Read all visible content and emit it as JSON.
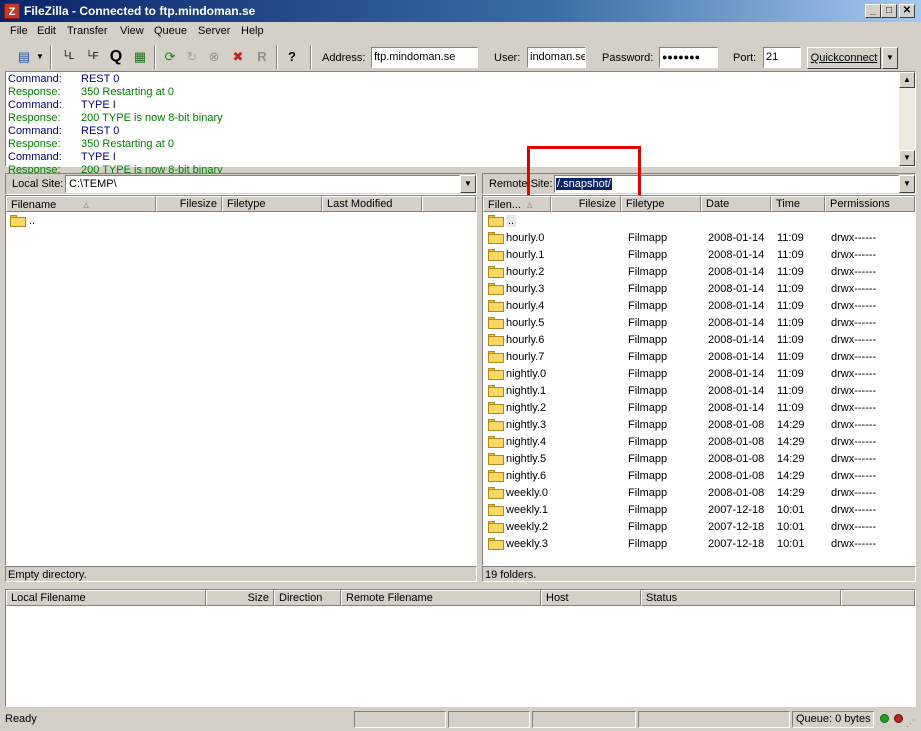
{
  "window": {
    "app_icon": "Z",
    "title": "FileZilla - Connected to ftp.mindoman.se"
  },
  "menu": [
    "File",
    "Edit",
    "Transfer",
    "View",
    "Queue",
    "Server",
    "Help"
  ],
  "toolbar": {
    "address_label": "Address:",
    "address_value": "ftp.mindoman.se",
    "user_label": "User:",
    "user_value": "indoman.se",
    "password_label": "Password:",
    "password_value": "●●●●●●●",
    "port_label": "Port:",
    "port_value": "21",
    "quickconnect_label": "Quickconnect"
  },
  "log": [
    {
      "kind": "Command:",
      "text": "REST 0",
      "type": "cmd"
    },
    {
      "kind": "Response:",
      "text": "350 Restarting at 0",
      "type": "resp"
    },
    {
      "kind": "Command:",
      "text": "TYPE I",
      "type": "cmd"
    },
    {
      "kind": "Response:",
      "text": "200 TYPE is now 8-bit binary",
      "type": "resp"
    },
    {
      "kind": "Command:",
      "text": "REST 0",
      "type": "cmd"
    },
    {
      "kind": "Response:",
      "text": "350 Restarting at 0",
      "type": "resp"
    },
    {
      "kind": "Command:",
      "text": "TYPE I",
      "type": "cmd"
    },
    {
      "kind": "Response:",
      "text": "200 TYPE is now 8-bit binary",
      "type": "resp"
    }
  ],
  "local": {
    "site_label": "Local Site:",
    "path": "C:\\TEMP\\",
    "columns": [
      "Filename",
      "Filesize",
      "Filetype",
      "Last Modified"
    ],
    "files": [
      {
        "name": ".."
      }
    ],
    "status": "Empty directory."
  },
  "remote": {
    "site_label": "Remote Site:",
    "path": "/.snapshot/",
    "columns": [
      "Filen...",
      "Filesize",
      "Filetype",
      "Date",
      "Time",
      "Permissions"
    ],
    "files": [
      {
        "name": "..",
        "type": "",
        "date": "",
        "time": "",
        "perm": ""
      },
      {
        "name": "hourly.0",
        "type": "Filmapp",
        "date": "2008-01-14",
        "time": "11:09",
        "perm": "drwx------"
      },
      {
        "name": "hourly.1",
        "type": "Filmapp",
        "date": "2008-01-14",
        "time": "11:09",
        "perm": "drwx------"
      },
      {
        "name": "hourly.2",
        "type": "Filmapp",
        "date": "2008-01-14",
        "time": "11:09",
        "perm": "drwx------"
      },
      {
        "name": "hourly.3",
        "type": "Filmapp",
        "date": "2008-01-14",
        "time": "11:09",
        "perm": "drwx------"
      },
      {
        "name": "hourly.4",
        "type": "Filmapp",
        "date": "2008-01-14",
        "time": "11:09",
        "perm": "drwx------"
      },
      {
        "name": "hourly.5",
        "type": "Filmapp",
        "date": "2008-01-14",
        "time": "11:09",
        "perm": "drwx------"
      },
      {
        "name": "hourly.6",
        "type": "Filmapp",
        "date": "2008-01-14",
        "time": "11:09",
        "perm": "drwx------"
      },
      {
        "name": "hourly.7",
        "type": "Filmapp",
        "date": "2008-01-14",
        "time": "11:09",
        "perm": "drwx------"
      },
      {
        "name": "nightly.0",
        "type": "Filmapp",
        "date": "2008-01-14",
        "time": "11:09",
        "perm": "drwx------"
      },
      {
        "name": "nightly.1",
        "type": "Filmapp",
        "date": "2008-01-14",
        "time": "11:09",
        "perm": "drwx------"
      },
      {
        "name": "nightly.2",
        "type": "Filmapp",
        "date": "2008-01-14",
        "time": "11:09",
        "perm": "drwx------"
      },
      {
        "name": "nightly.3",
        "type": "Filmapp",
        "date": "2008-01-08",
        "time": "14:29",
        "perm": "drwx------"
      },
      {
        "name": "nightly.4",
        "type": "Filmapp",
        "date": "2008-01-08",
        "time": "14:29",
        "perm": "drwx------"
      },
      {
        "name": "nightly.5",
        "type": "Filmapp",
        "date": "2008-01-08",
        "time": "14:29",
        "perm": "drwx------"
      },
      {
        "name": "nightly.6",
        "type": "Filmapp",
        "date": "2008-01-08",
        "time": "14:29",
        "perm": "drwx------"
      },
      {
        "name": "weekly.0",
        "type": "Filmapp",
        "date": "2008-01-08",
        "time": "14:29",
        "perm": "drwx------"
      },
      {
        "name": "weekly.1",
        "type": "Filmapp",
        "date": "2007-12-18",
        "time": "10:01",
        "perm": "drwx------"
      },
      {
        "name": "weekly.2",
        "type": "Filmapp",
        "date": "2007-12-18",
        "time": "10:01",
        "perm": "drwx------"
      },
      {
        "name": "weekly.3",
        "type": "Filmapp",
        "date": "2007-12-18",
        "time": "10:01",
        "perm": "drwx------"
      }
    ],
    "status": "19 folders."
  },
  "queue": {
    "columns": [
      "Local Filename",
      "Size",
      "Direction",
      "Remote Filename",
      "Host",
      "Status"
    ]
  },
  "statusbar": {
    "ready": "Ready",
    "queue": "Queue: 0 bytes"
  },
  "colors": {
    "highlight_box": "#e00000",
    "selection": "#0a246a",
    "title_start": "#0a246a",
    "title_end": "#a6caf0"
  }
}
